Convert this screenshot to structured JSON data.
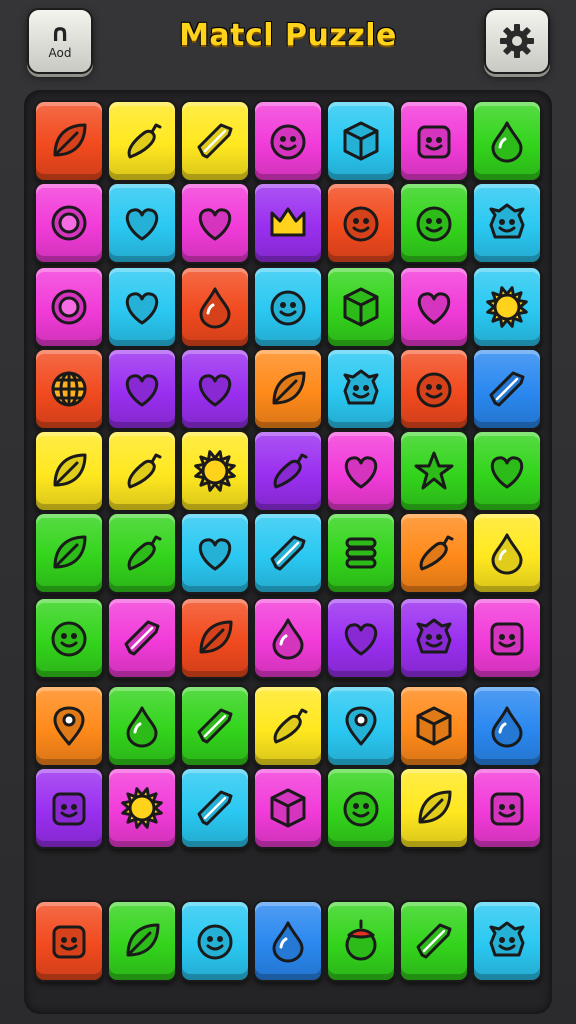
{
  "header": {
    "title": "Matcl Puzzle",
    "left_button_label": "Aod",
    "left_button_glyph": "∩",
    "settings_icon": "gear-icon"
  },
  "colors": {
    "red": "#f24a1e",
    "orange": "#ff8a1a",
    "yellow": "#ffe81f",
    "green": "#33d41c",
    "cyan": "#2ac8f2",
    "blue": "#2a88f0",
    "magenta": "#f23bd9",
    "purple": "#9a2ff0",
    "title": "#ffd21c"
  },
  "board": {
    "rows": [
      [
        {
          "color": "red",
          "icon": "leaf"
        },
        {
          "color": "yellow",
          "icon": "chili"
        },
        {
          "color": "yellow",
          "icon": "gem"
        },
        {
          "color": "magenta",
          "icon": "face"
        },
        {
          "color": "cyan",
          "icon": "cube"
        },
        {
          "color": "magenta",
          "icon": "block-face"
        },
        {
          "color": "green",
          "icon": "drop"
        }
      ],
      [
        {
          "color": "magenta",
          "icon": "ring"
        },
        {
          "color": "cyan",
          "icon": "heart"
        },
        {
          "color": "magenta",
          "icon": "heart"
        },
        {
          "color": "purple",
          "icon": "crown"
        },
        {
          "color": "red",
          "icon": "face"
        },
        {
          "color": "green",
          "icon": "face"
        },
        {
          "color": "cyan",
          "icon": "monster"
        }
      ],
      [
        {
          "color": "magenta",
          "icon": "ring"
        },
        {
          "color": "cyan",
          "icon": "heart"
        },
        {
          "color": "red",
          "icon": "drop"
        },
        {
          "color": "cyan",
          "icon": "face"
        },
        {
          "color": "green",
          "icon": "cube"
        },
        {
          "color": "magenta",
          "icon": "heart"
        },
        {
          "color": "cyan",
          "icon": "sun"
        }
      ],
      [
        {
          "color": "red",
          "icon": "globe"
        },
        {
          "color": "purple",
          "icon": "heart"
        },
        {
          "color": "purple",
          "icon": "heart"
        },
        {
          "color": "orange",
          "icon": "leaf"
        },
        {
          "color": "cyan",
          "icon": "monster"
        },
        {
          "color": "red",
          "icon": "face"
        },
        {
          "color": "blue",
          "icon": "gem"
        }
      ],
      [
        {
          "color": "yellow",
          "icon": "leaf"
        },
        {
          "color": "yellow",
          "icon": "chili"
        },
        {
          "color": "yellow",
          "icon": "sun"
        },
        {
          "color": "purple",
          "icon": "chili"
        },
        {
          "color": "magenta",
          "icon": "heart"
        },
        {
          "color": "green",
          "icon": "star"
        },
        {
          "color": "green",
          "icon": "heart"
        }
      ],
      [
        {
          "color": "green",
          "icon": "leaf"
        },
        {
          "color": "green",
          "icon": "chili"
        },
        {
          "color": "cyan",
          "icon": "heart"
        },
        {
          "color": "cyan",
          "icon": "gem"
        },
        {
          "color": "green",
          "icon": "stack"
        },
        {
          "color": "orange",
          "icon": "chili"
        },
        {
          "color": "yellow",
          "icon": "drop"
        }
      ],
      [
        {
          "color": "green",
          "icon": "face"
        },
        {
          "color": "magenta",
          "icon": "gem"
        },
        {
          "color": "red",
          "icon": "leaf"
        },
        {
          "color": "magenta",
          "icon": "drop"
        },
        {
          "color": "purple",
          "icon": "heart"
        },
        {
          "color": "purple",
          "icon": "monster"
        },
        {
          "color": "magenta",
          "icon": "block-face"
        }
      ],
      [
        {
          "color": "orange",
          "icon": "pin"
        },
        {
          "color": "green",
          "icon": "drop"
        },
        {
          "color": "green",
          "icon": "gem"
        },
        {
          "color": "yellow",
          "icon": "chili"
        },
        {
          "color": "cyan",
          "icon": "pin"
        },
        {
          "color": "orange",
          "icon": "cube"
        },
        {
          "color": "blue",
          "icon": "drop"
        }
      ],
      [
        {
          "color": "purple",
          "icon": "block-face"
        },
        {
          "color": "magenta",
          "icon": "sun"
        },
        {
          "color": "cyan",
          "icon": "gem"
        },
        {
          "color": "magenta",
          "icon": "cube"
        },
        {
          "color": "green",
          "icon": "face"
        },
        {
          "color": "yellow",
          "icon": "leaf"
        },
        {
          "color": "magenta",
          "icon": "block-face"
        }
      ],
      [
        {
          "color": "red",
          "icon": "block-face"
        },
        {
          "color": "green",
          "icon": "leaf"
        },
        {
          "color": "cyan",
          "icon": "face"
        },
        {
          "color": "blue",
          "icon": "drop"
        },
        {
          "color": "green",
          "icon": "apple"
        },
        {
          "color": "green",
          "icon": "gem"
        },
        {
          "color": "cyan",
          "icon": "monster"
        }
      ]
    ]
  }
}
